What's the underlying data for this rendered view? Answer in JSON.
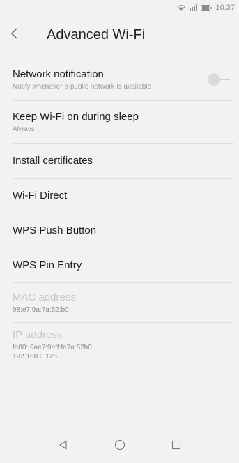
{
  "status_bar": {
    "time": "10:37"
  },
  "header": {
    "title": "Advanced Wi-Fi"
  },
  "settings": {
    "network_notification": {
      "title": "Network notification",
      "summary": "Notify whenever a public network is available",
      "toggle_on": false
    },
    "keep_wifi_on": {
      "title": "Keep Wi-Fi on during sleep",
      "summary": "Always"
    },
    "install_certificates": {
      "title": "Install certificates"
    },
    "wifi_direct": {
      "title": "Wi-Fi Direct"
    },
    "wps_push": {
      "title": "WPS Push Button"
    },
    "wps_pin": {
      "title": "WPS Pin Entry"
    },
    "mac_address": {
      "title": "MAC address",
      "value": "98:e7:9a:7a:52:b0"
    },
    "ip_address": {
      "title": "IP address",
      "value_ipv6": "fe80::9ae7:9aff:fe7a:52b0",
      "value_ipv4": "192.168.0.126"
    }
  },
  "icons": {
    "wifi": "wifi-icon",
    "signal": "signal-icon",
    "battery": "battery-icon",
    "back": "chevron-left-icon",
    "nav_back": "nav-back-icon",
    "nav_home": "nav-home-icon",
    "nav_recents": "nav-recents-icon"
  }
}
